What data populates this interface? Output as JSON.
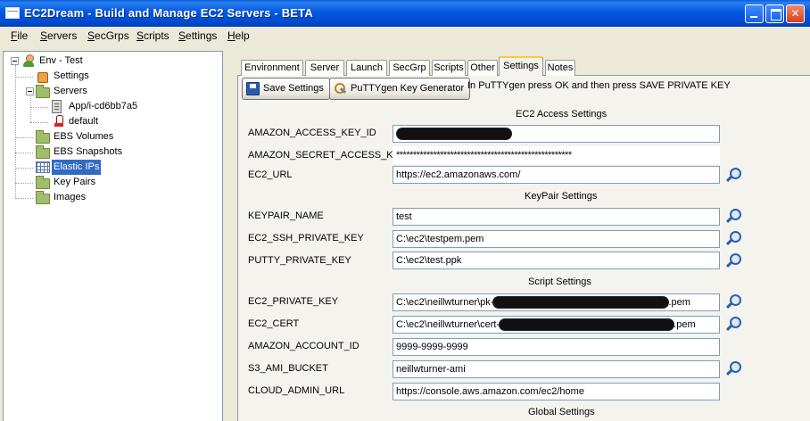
{
  "window": {
    "title": "EC2Dream - Build and Manage EC2 Servers - BETA",
    "colors": {
      "titlebar": "#0058e0",
      "selection": "#316ac5",
      "active_tab_accent": "#ffc83c"
    }
  },
  "menu": [
    {
      "key": "F",
      "rest": "ile"
    },
    {
      "key": "S",
      "rest": "ervers"
    },
    {
      "key": "S",
      "rest": "ecGrps"
    },
    {
      "key": "S",
      "rest": "cripts"
    },
    {
      "key": "S",
      "rest": "ettings"
    },
    {
      "key": "H",
      "rest": "elp"
    }
  ],
  "tree": {
    "root": "Env - Test",
    "settings": "Settings",
    "servers": "Servers",
    "server_instance": "App/i-cd6bb7a5",
    "server_default": "default",
    "ebs_volumes": "EBS Volumes",
    "ebs_snapshots": "EBS Snapshots",
    "elastic_ips": "Elastic IPs",
    "key_pairs": "Key Pairs",
    "images": "Images",
    "selected": "Elastic IPs"
  },
  "tabs": [
    "Environment",
    "Server",
    "Launch",
    "SecGrp",
    "Scripts",
    "Other",
    "Settings",
    "Notes"
  ],
  "active_tab": "Settings",
  "toolbar": {
    "save_label": "Save Settings",
    "puttygen_label": "PuTTYgen Key Generator",
    "hint": "In PuTTYgen press OK and then press SAVE PRIVATE KEY"
  },
  "sections": {
    "ec2_access": "EC2 Access Settings",
    "keypair": "KeyPair Settings",
    "script": "Script Settings",
    "global": "Global Settings"
  },
  "fields": {
    "amazon_access_key_id": {
      "label": "AMAZON_ACCESS_KEY_ID",
      "value": ""
    },
    "amazon_secret_access_key": {
      "label": "AMAZON_SECRET_ACCESS_KEY",
      "value": "****************************************************"
    },
    "ec2_url": {
      "label": "EC2_URL",
      "value": "https://ec2.amazonaws.com/"
    },
    "keypair_name": {
      "label": "KEYPAIR_NAME",
      "value": "test"
    },
    "ec2_ssh_private_key": {
      "label": "EC2_SSH_PRIVATE_KEY",
      "value": "C:\\ec2\\testpem.pem"
    },
    "putty_private_key": {
      "label": "PUTTY_PRIVATE_KEY",
      "value": "C:\\ec2\\test.ppk"
    },
    "ec2_private_key": {
      "label": "EC2_PRIVATE_KEY",
      "value_prefix": "C:\\ec2\\neillwturner\\pk-",
      "value_suffix": ".pem"
    },
    "ec2_cert": {
      "label": "EC2_CERT",
      "value_prefix": "C:\\ec2\\neillwturner\\cert-",
      "value_suffix": ".pem"
    },
    "amazon_account_id": {
      "label": "AMAZON_ACCOUNT_ID",
      "value": "9999-9999-9999"
    },
    "s3_ami_bucket": {
      "label": "S3_AMI_BUCKET",
      "value": "neillwturner-ami"
    },
    "cloud_admin_url": {
      "label": "CLOUD_ADMIN_URL",
      "value": "https://console.aws.amazon.com/ec2/home"
    }
  }
}
